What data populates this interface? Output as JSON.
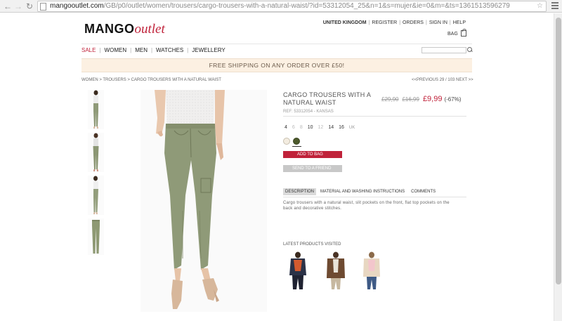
{
  "browser": {
    "url_host": "mangooutlet.com",
    "url_path": "/GB/p0/outlet/women/trousers/cargo-trousers-with-a-natural-waist/?id=53312054_25&n=1&s=mujer&ie=0&m=&ts=1361513596279"
  },
  "header": {
    "logo_brand": "MANGO",
    "logo_sub": "outlet",
    "country": "UNITED KINGDOM",
    "links": [
      "REGISTER",
      "ORDERS",
      "SIGN IN",
      "HELP"
    ],
    "bag_label": "BAG"
  },
  "nav": {
    "items": [
      "SALE",
      "WOMEN",
      "MEN",
      "WATCHES",
      "JEWELLERY"
    ]
  },
  "banner": {
    "text": "FREE SHIPPING ON ANY ORDER OVER £50!"
  },
  "breadcrumb": {
    "text": "WOMEN > TROUSERS > CARGO TROUSERS WITH A NATURAL WAIST"
  },
  "pager": {
    "text": "<<PREVIOUS 29 / 103  NEXT >>"
  },
  "product": {
    "title": "CARGO TROUSERS WITH A NATURAL WAIST",
    "ref": "REF: 53312054 - KANSAS",
    "price_old_1": "£29,90",
    "price_old_2": "£16,99",
    "price_new": "£9,99",
    "discount": "(-67%)",
    "sizes": [
      {
        "label": "4",
        "available": true
      },
      {
        "label": "6",
        "available": false
      },
      {
        "label": "8",
        "available": false
      },
      {
        "label": "10",
        "available": true
      },
      {
        "label": "12",
        "available": false
      },
      {
        "label": "14",
        "available": true
      },
      {
        "label": "16",
        "available": true
      }
    ],
    "size_unit": "UK",
    "colors": [
      "#f3ece0",
      "#4d5a2c"
    ],
    "add_to_bag": "ADD TO BAG",
    "send_to_friend": "SEND TO A FRIEND",
    "tabs": [
      "DESCRIPTION",
      "MATERIAL AND WASHING INSTRUCTIONS",
      "COMMENTS"
    ],
    "description": "Cargo trousers with a natural waist, slit pockets on the front, flat top pockets on the back and decorative stitches."
  },
  "latest": {
    "title": "LATEST PRODUCTS VISITED"
  },
  "colors": {
    "accent": "#c0223a",
    "banner_bg": "#fcf0e2",
    "trouser_khaki": "#8f9a78"
  }
}
